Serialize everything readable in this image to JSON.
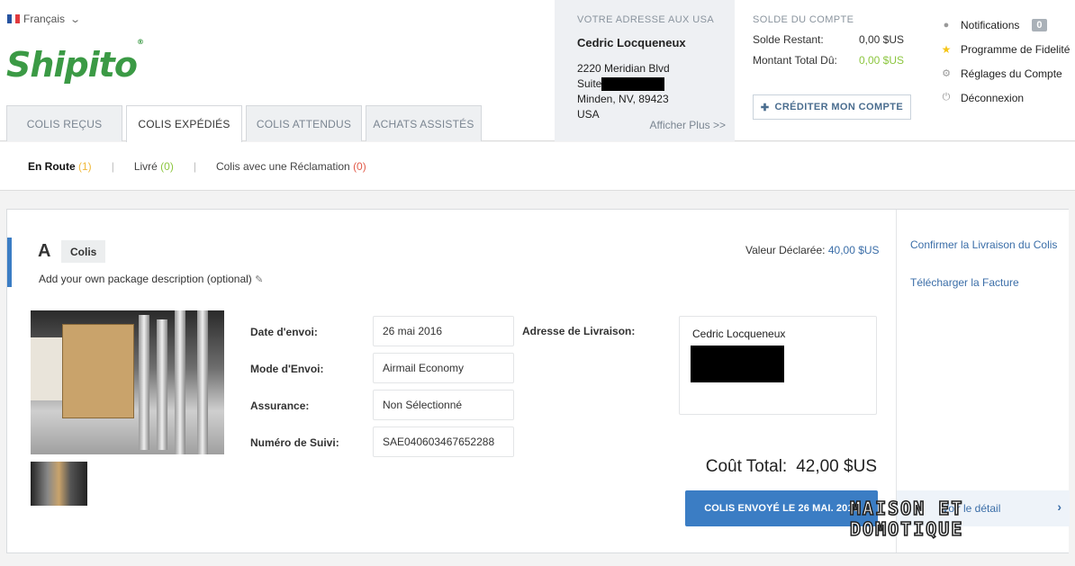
{
  "header": {
    "language": "Français",
    "logo_text": "Shipito",
    "tabs": [
      {
        "label": "COLIS REÇUS",
        "active": false
      },
      {
        "label": "COLIS EXPÉDIÉS",
        "active": true
      },
      {
        "label": "COLIS ATTENDUS",
        "active": false
      },
      {
        "label": "ACHATS ASSISTÉS",
        "active": false
      }
    ],
    "us_address": {
      "label": "VOTRE ADRESSE AUX USA",
      "name": "Cedric Locqueneux",
      "line1": "2220 Meridian Blvd",
      "suite_label": "Suite",
      "line3": "Minden, NV, 89423",
      "country": "USA",
      "more_link": "Afficher Plus >>"
    },
    "balance": {
      "label": "SOLDE DU COMPTE",
      "remaining_label": "Solde Restant:",
      "remaining_value": "0,00 $US",
      "due_label": "Montant Total Dû:",
      "due_value": "0,00 $US",
      "credit_button": "CRÉDITER MON COMPTE"
    },
    "account_menu": {
      "notifications": "Notifications",
      "notifications_count": "0",
      "loyalty": "Programme de Fidelité",
      "settings": "Réglages du Compte",
      "logout": "Déconnexion"
    }
  },
  "subnav": {
    "en_route": "En Route",
    "en_route_count": "(1)",
    "delivered": "Livré",
    "delivered_count": "(0)",
    "claims": "Colis avec une Réclamation",
    "claims_count": "(0)",
    "separator": "|"
  },
  "package": {
    "letter": "A",
    "tag": "Colis",
    "description": "Add your own package description (optional)",
    "declared_label": "Valeur Déclarée:",
    "declared_value": "40,00 $US",
    "fields": [
      {
        "label": "Date d'envoi:",
        "value": "26 mai 2016"
      },
      {
        "label": "Mode d'Envoi:",
        "value": "Airmail Economy"
      },
      {
        "label": "Assurance:",
        "value": "Non Sélectionné"
      },
      {
        "label": "Numéro de Suivi:",
        "value": "SAE040603467652288"
      }
    ],
    "delivery_label": "Adresse de Livraison:",
    "delivery_name": "Cedric Locqueneux",
    "total_label": "Coût Total:",
    "total_value": "42,00 $US",
    "sent_button": "COLIS ENVOYÉ LE 26 MAI. 2016"
  },
  "side": {
    "confirm": "Confirmer la Livraison du Colis",
    "invoice": "Télécharger la Facture",
    "details": "Voir le détail"
  },
  "watermark": {
    "line1": "MAISON ET",
    "line2": "DOMOTIQUE"
  },
  "colors": {
    "brand_green": "#3b9a45",
    "link_blue": "#3b6ea8",
    "button_blue": "#3b7dc4",
    "status_green": "#8cc63f",
    "status_red": "#e25b4a",
    "status_yellow": "#f0b93a"
  }
}
